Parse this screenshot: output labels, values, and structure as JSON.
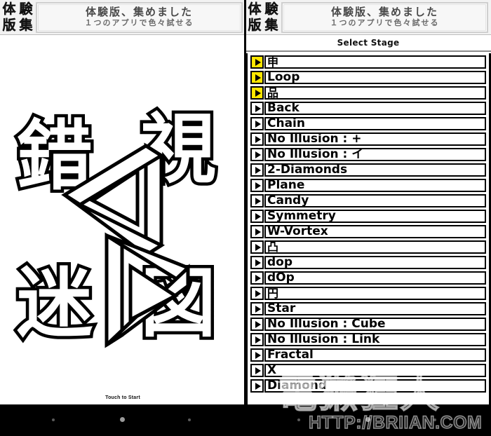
{
  "ad_banner": {
    "logo_chars": [
      "体",
      "験",
      "版",
      "集"
    ],
    "line1": "体験版、集めました",
    "line2": "１つのアプリで色々試せる"
  },
  "splash": {
    "title_chars": [
      "錯",
      "視",
      "迷",
      "図"
    ],
    "figure_name": "penrose-impossible-figure",
    "touch_to_start": "Touch to Start"
  },
  "stage_select": {
    "header": "Select Stage",
    "active_color": "#ffe600",
    "rows": [
      {
        "label": "申",
        "active": true,
        "cjk": true
      },
      {
        "label": "Loop",
        "active": true,
        "cjk": false
      },
      {
        "label": "品",
        "active": true,
        "cjk": true
      },
      {
        "label": "Back",
        "active": false,
        "cjk": false
      },
      {
        "label": "Chain",
        "active": false,
        "cjk": false
      },
      {
        "label": "No Illusion : +",
        "active": false,
        "cjk": false
      },
      {
        "label": "No Illusion : イ",
        "active": false,
        "cjk": false
      },
      {
        "label": "2-Diamonds",
        "active": false,
        "cjk": false
      },
      {
        "label": "Plane",
        "active": false,
        "cjk": false
      },
      {
        "label": "Candy",
        "active": false,
        "cjk": false
      },
      {
        "label": "Symmetry",
        "active": false,
        "cjk": false
      },
      {
        "label": "W-Vortex",
        "active": false,
        "cjk": false
      },
      {
        "label": "凸",
        "active": false,
        "cjk": true
      },
      {
        "label": "dop",
        "active": false,
        "cjk": false
      },
      {
        "label": "dOp",
        "active": false,
        "cjk": false
      },
      {
        "label": "円",
        "active": false,
        "cjk": true
      },
      {
        "label": "Star",
        "active": false,
        "cjk": false
      },
      {
        "label": "No Illusion : Cube",
        "active": false,
        "cjk": false
      },
      {
        "label": "No Illusion : Link",
        "active": false,
        "cjk": false
      },
      {
        "label": "Fractal",
        "active": false,
        "cjk": false
      },
      {
        "label": "X",
        "active": false,
        "cjk": false
      },
      {
        "label": "Diamond",
        "active": false,
        "cjk": false
      }
    ]
  },
  "nav_bar": {
    "buttons": [
      "back-dot",
      "home-dot",
      "recents-dot"
    ]
  },
  "watermark": {
    "cjk": "電獺狂人",
    "url": "HTTP://BRIIAN.COM"
  }
}
